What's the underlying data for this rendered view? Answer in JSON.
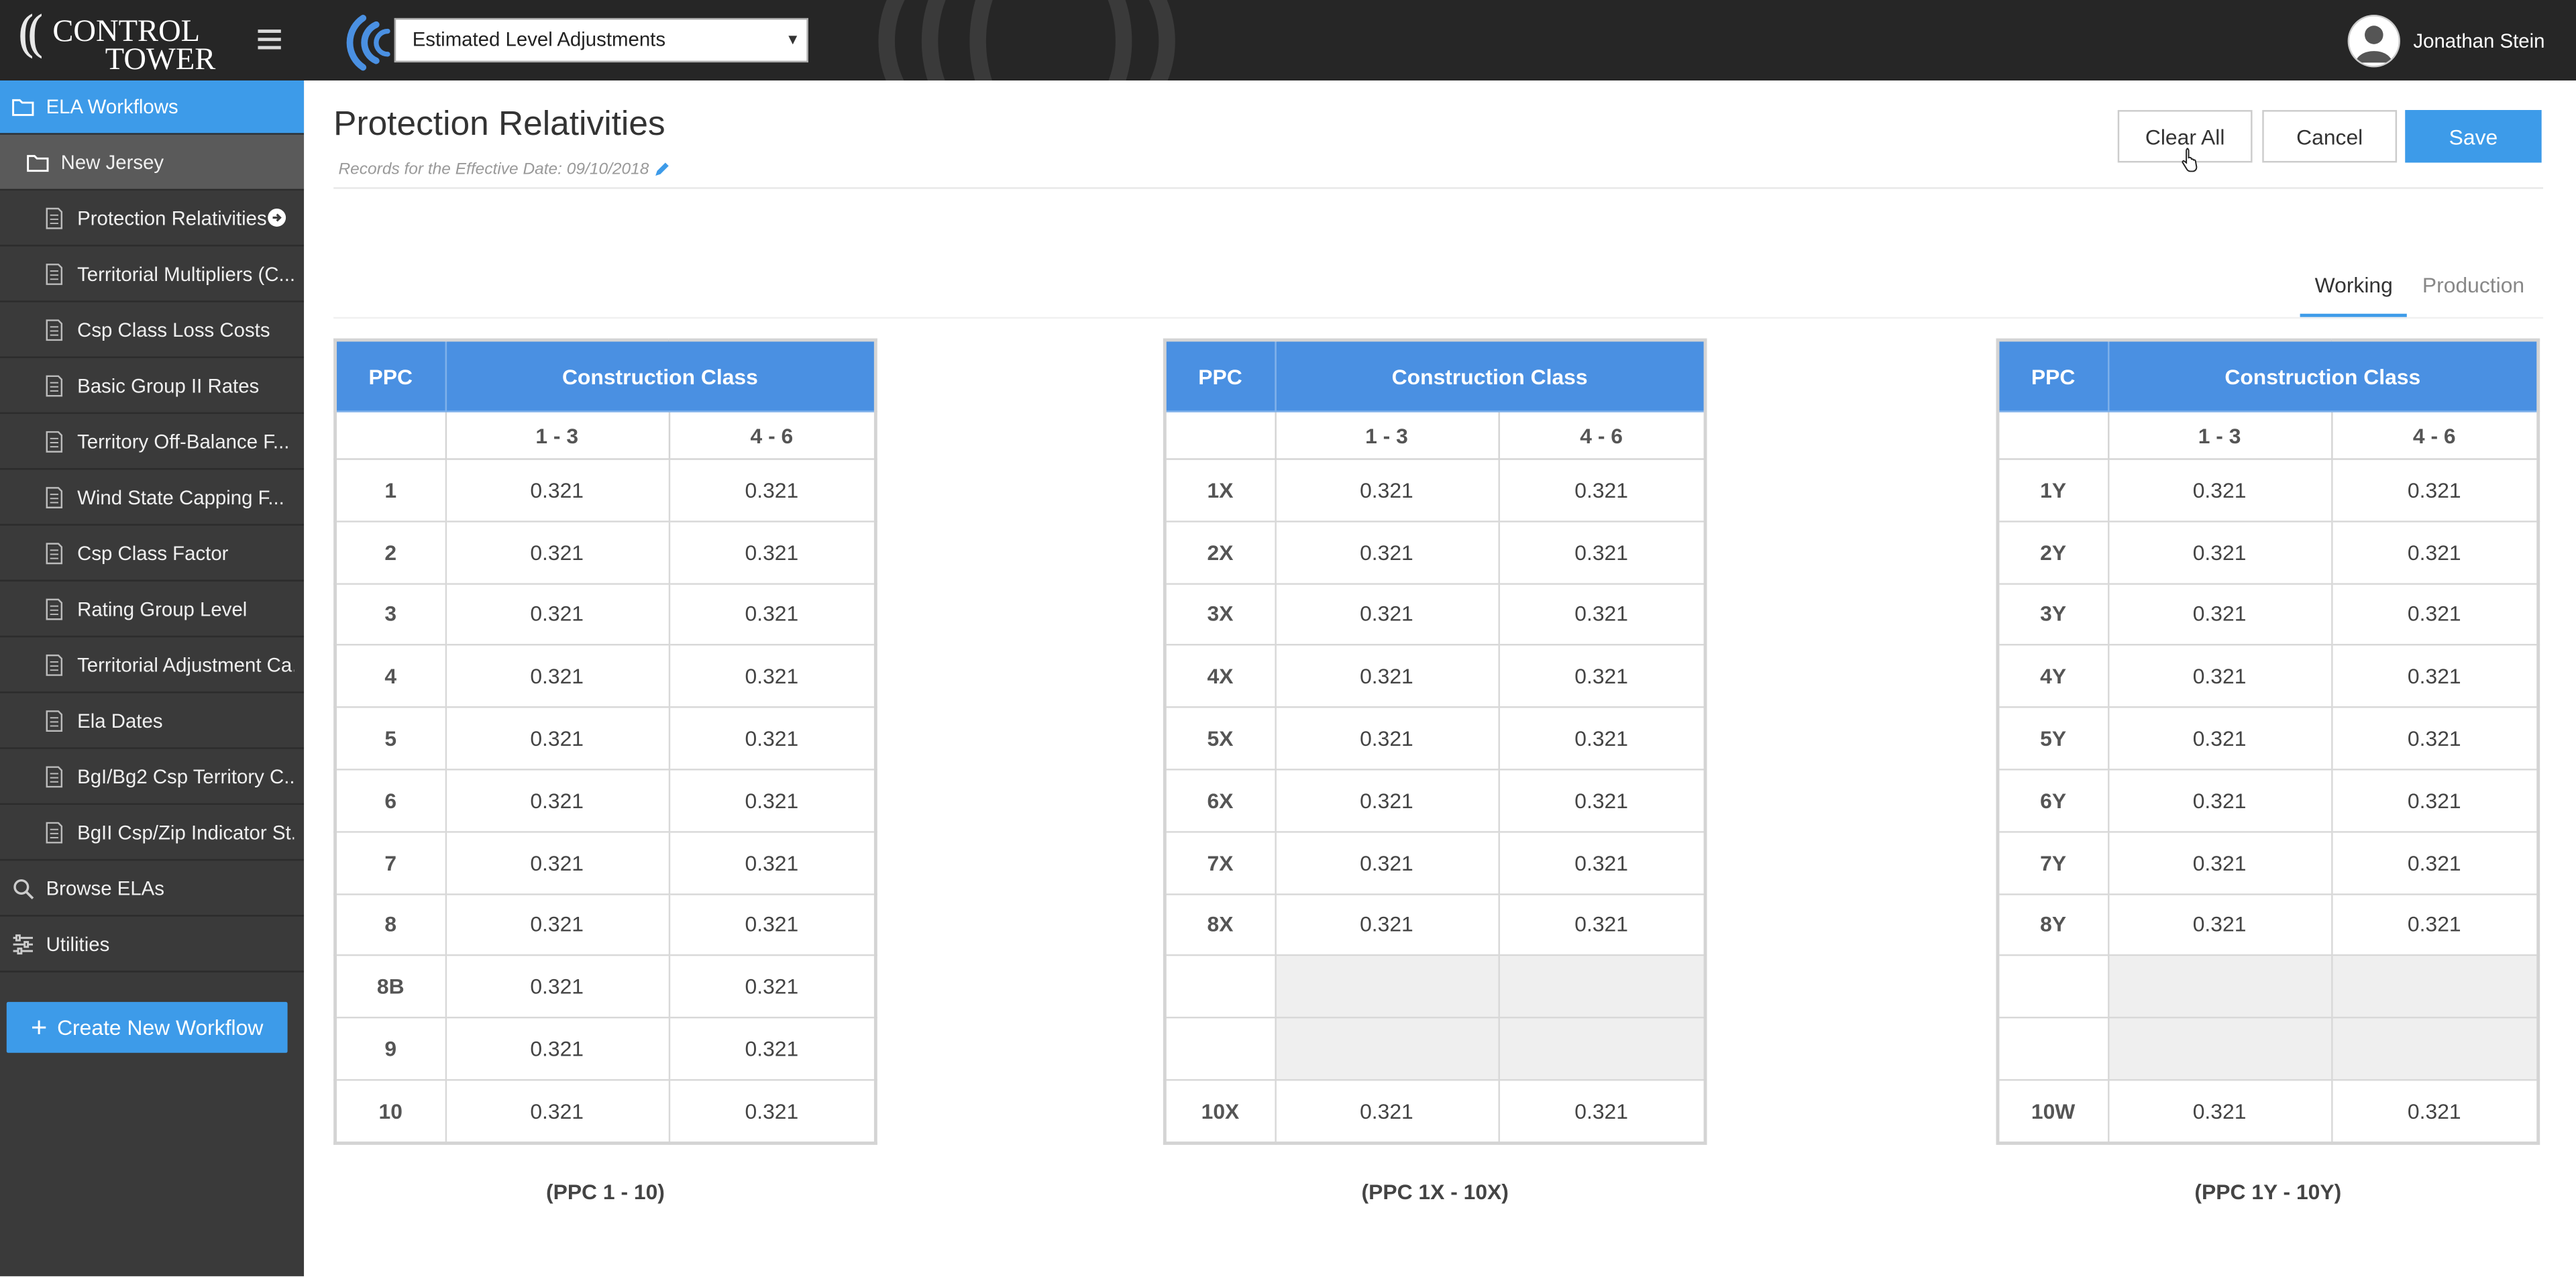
{
  "header": {
    "logo_line1": "CONTROL",
    "logo_line2": "TOWER",
    "app_select": "Estimated Level Adjustments",
    "user_name": "Jonathan Stein"
  },
  "sidebar": {
    "workflows_label": "ELA Workflows",
    "folder_label": "New Jersey",
    "items": [
      "Protection Relativities",
      "Territorial Multipliers (C...",
      "Csp Class Loss Costs",
      "Basic Group II Rates",
      "Territory Off-Balance F...",
      "Wind State Capping F...",
      "Csp Class Factor",
      "Rating Group Level",
      "Territorial Adjustment Ca..",
      "Ela Dates",
      "BgI/Bg2 Csp Territory C..",
      "BgII Csp/Zip Indicator St.."
    ],
    "browse_label": "Browse ELAs",
    "utilities_label": "Utilities",
    "create_label": "Create New Workflow"
  },
  "page": {
    "title": "Protection Relativities",
    "subtitle": "Records for the Effective Date: 09/10/2018",
    "clear_label": "Clear All",
    "cancel_label": "Cancel",
    "save_label": "Save",
    "tabs": [
      "Working",
      "Production"
    ],
    "active_tab": "Working"
  },
  "tables": [
    {
      "ppc_header": "PPC",
      "group_header": "Construction Class",
      "col1": "1 - 3",
      "col2": "4 - 6",
      "caption": "(PPC 1 - 10)",
      "rows": [
        {
          "ppc": "1",
          "a": "0.321",
          "b": "0.321"
        },
        {
          "ppc": "2",
          "a": "0.321",
          "b": "0.321"
        },
        {
          "ppc": "3",
          "a": "0.321",
          "b": "0.321"
        },
        {
          "ppc": "4",
          "a": "0.321",
          "b": "0.321"
        },
        {
          "ppc": "5",
          "a": "0.321",
          "b": "0.321"
        },
        {
          "ppc": "6",
          "a": "0.321",
          "b": "0.321"
        },
        {
          "ppc": "7",
          "a": "0.321",
          "b": "0.321"
        },
        {
          "ppc": "8",
          "a": "0.321",
          "b": "0.321"
        },
        {
          "ppc": "8B",
          "a": "0.321",
          "b": "0.321"
        },
        {
          "ppc": "9",
          "a": "0.321",
          "b": "0.321"
        },
        {
          "ppc": "10",
          "a": "0.321",
          "b": "0.321"
        }
      ]
    },
    {
      "ppc_header": "PPC",
      "group_header": "Construction Class",
      "col1": "1 - 3",
      "col2": "4 - 6",
      "caption": "(PPC 1X - 10X)",
      "rows": [
        {
          "ppc": "1X",
          "a": "0.321",
          "b": "0.321"
        },
        {
          "ppc": "2X",
          "a": "0.321",
          "b": "0.321"
        },
        {
          "ppc": "3X",
          "a": "0.321",
          "b": "0.321"
        },
        {
          "ppc": "4X",
          "a": "0.321",
          "b": "0.321"
        },
        {
          "ppc": "5X",
          "a": "0.321",
          "b": "0.321"
        },
        {
          "ppc": "6X",
          "a": "0.321",
          "b": "0.321"
        },
        {
          "ppc": "7X",
          "a": "0.321",
          "b": "0.321"
        },
        {
          "ppc": "8X",
          "a": "0.321",
          "b": "0.321"
        },
        {
          "ppc": "",
          "a": "",
          "b": "",
          "empty": true
        },
        {
          "ppc": "",
          "a": "",
          "b": "",
          "empty": true
        },
        {
          "ppc": "10X",
          "a": "0.321",
          "b": "0.321"
        }
      ]
    },
    {
      "ppc_header": "PPC",
      "group_header": "Construction Class",
      "col1": "1 - 3",
      "col2": "4 - 6",
      "caption": "(PPC 1Y -  10Y)",
      "rows": [
        {
          "ppc": "1Y",
          "a": "0.321",
          "b": "0.321"
        },
        {
          "ppc": "2Y",
          "a": "0.321",
          "b": "0.321"
        },
        {
          "ppc": "3Y",
          "a": "0.321",
          "b": "0.321"
        },
        {
          "ppc": "4Y",
          "a": "0.321",
          "b": "0.321"
        },
        {
          "ppc": "5Y",
          "a": "0.321",
          "b": "0.321"
        },
        {
          "ppc": "6Y",
          "a": "0.321",
          "b": "0.321"
        },
        {
          "ppc": "7Y",
          "a": "0.321",
          "b": "0.321"
        },
        {
          "ppc": "8Y",
          "a": "0.321",
          "b": "0.321"
        },
        {
          "ppc": "",
          "a": "",
          "b": "",
          "empty": true
        },
        {
          "ppc": "",
          "a": "",
          "b": "",
          "empty": true
        },
        {
          "ppc": "10W",
          "a": "0.321",
          "b": "0.321"
        }
      ]
    }
  ],
  "colors": {
    "accent": "#3d9be9",
    "table_header": "#4a90e2",
    "topbar": "#262626",
    "sidebar": "#3a3a3a"
  }
}
